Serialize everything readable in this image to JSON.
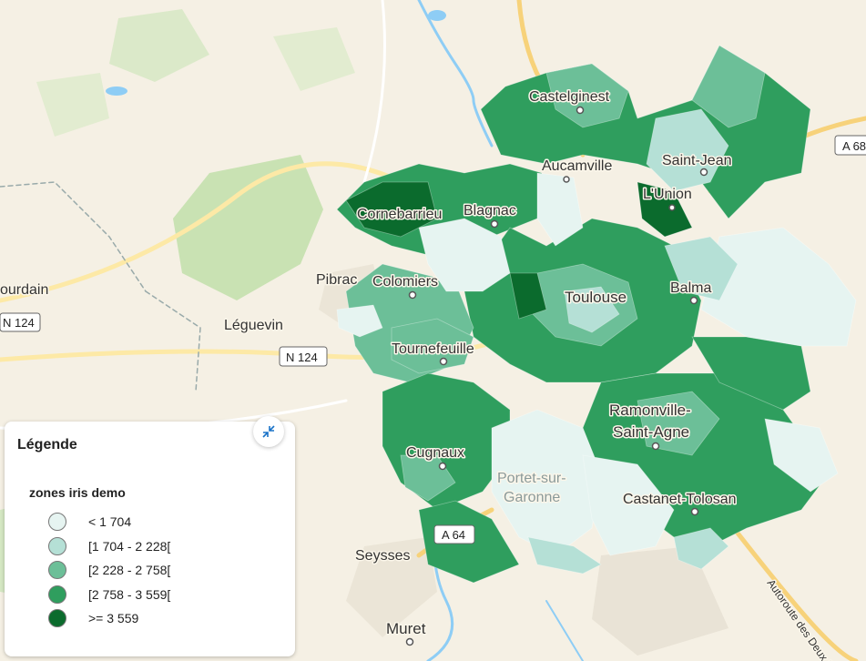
{
  "map": {
    "places": [
      {
        "name": "Castelginest",
        "cls": "mid"
      },
      {
        "name": "Aucamville",
        "cls": "mid"
      },
      {
        "name": "Saint-Jean",
        "cls": "mid"
      },
      {
        "name": "L'Union",
        "cls": "mid"
      },
      {
        "name": "Cornebarrieu",
        "cls": "mid"
      },
      {
        "name": "Blagnac",
        "cls": "mid"
      },
      {
        "name": "Pibrac",
        "cls": "mid"
      },
      {
        "name": "Colomiers",
        "cls": "mid"
      },
      {
        "name": "Toulouse",
        "cls": "big"
      },
      {
        "name": "Balma",
        "cls": "mid"
      },
      {
        "name": "ourdain",
        "cls": "mid"
      },
      {
        "name": "Léguevin",
        "cls": "mid"
      },
      {
        "name": "Tournefeuille",
        "cls": "mid"
      },
      {
        "name": "Ramonville-",
        "cls": "big"
      },
      {
        "name": "Saint-Agne",
        "cls": "big"
      },
      {
        "name": "Cugnaux",
        "cls": "mid"
      },
      {
        "name": "Portet-sur-",
        "cls": "faint"
      },
      {
        "name": "Garonne",
        "cls": "faint"
      },
      {
        "name": "Castanet-Tolosan",
        "cls": "mid"
      },
      {
        "name": "Seysses",
        "cls": "mid"
      },
      {
        "name": "Muret",
        "cls": "big"
      },
      {
        "name": "Autoroute des Deux M",
        "cls": "road"
      }
    ],
    "shields": [
      "N 124",
      "N 124",
      "A 64",
      "A 68"
    ]
  },
  "legend": {
    "title": "Légende",
    "layer_name": "zones iris demo",
    "collapse_icon": "collapse-icon",
    "classes": [
      {
        "label": "< 1 704",
        "color": "#e6f4f1"
      },
      {
        "label": "[1 704 - 2 228[",
        "color": "#b5e0d6"
      },
      {
        "label": "[2 228 - 2 758[",
        "color": "#6cbf98"
      },
      {
        "label": "[2 758 - 3 559[",
        "color": "#2f9e5e"
      },
      {
        "label": ">= 3 559",
        "color": "#0b6b2d"
      }
    ]
  }
}
